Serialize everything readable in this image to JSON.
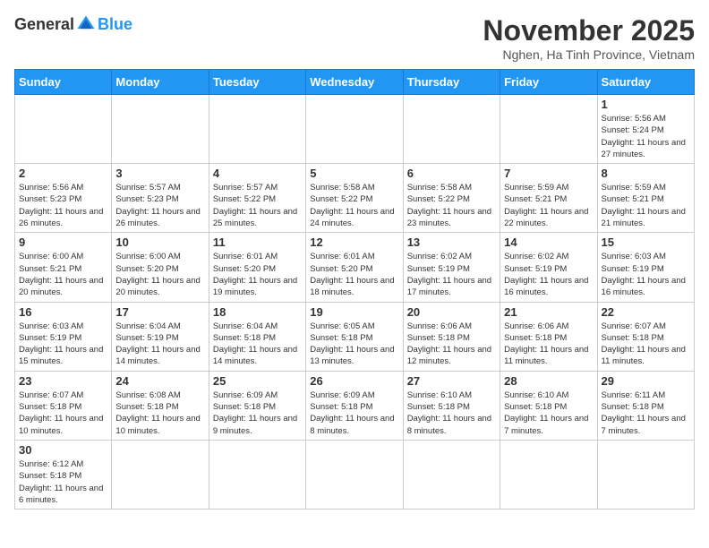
{
  "header": {
    "logo_general": "General",
    "logo_blue": "Blue",
    "month_title": "November 2025",
    "location": "Nghen, Ha Tinh Province, Vietnam"
  },
  "days_of_week": [
    "Sunday",
    "Monday",
    "Tuesday",
    "Wednesday",
    "Thursday",
    "Friday",
    "Saturday"
  ],
  "weeks": [
    [
      {
        "day": "",
        "info": ""
      },
      {
        "day": "",
        "info": ""
      },
      {
        "day": "",
        "info": ""
      },
      {
        "day": "",
        "info": ""
      },
      {
        "day": "",
        "info": ""
      },
      {
        "day": "",
        "info": ""
      },
      {
        "day": "1",
        "info": "Sunrise: 5:56 AM\nSunset: 5:24 PM\nDaylight: 11 hours and 27 minutes."
      }
    ],
    [
      {
        "day": "2",
        "info": "Sunrise: 5:56 AM\nSunset: 5:23 PM\nDaylight: 11 hours and 26 minutes."
      },
      {
        "day": "3",
        "info": "Sunrise: 5:57 AM\nSunset: 5:23 PM\nDaylight: 11 hours and 26 minutes."
      },
      {
        "day": "4",
        "info": "Sunrise: 5:57 AM\nSunset: 5:22 PM\nDaylight: 11 hours and 25 minutes."
      },
      {
        "day": "5",
        "info": "Sunrise: 5:58 AM\nSunset: 5:22 PM\nDaylight: 11 hours and 24 minutes."
      },
      {
        "day": "6",
        "info": "Sunrise: 5:58 AM\nSunset: 5:22 PM\nDaylight: 11 hours and 23 minutes."
      },
      {
        "day": "7",
        "info": "Sunrise: 5:59 AM\nSunset: 5:21 PM\nDaylight: 11 hours and 22 minutes."
      },
      {
        "day": "8",
        "info": "Sunrise: 5:59 AM\nSunset: 5:21 PM\nDaylight: 11 hours and 21 minutes."
      }
    ],
    [
      {
        "day": "9",
        "info": "Sunrise: 6:00 AM\nSunset: 5:21 PM\nDaylight: 11 hours and 20 minutes."
      },
      {
        "day": "10",
        "info": "Sunrise: 6:00 AM\nSunset: 5:20 PM\nDaylight: 11 hours and 20 minutes."
      },
      {
        "day": "11",
        "info": "Sunrise: 6:01 AM\nSunset: 5:20 PM\nDaylight: 11 hours and 19 minutes."
      },
      {
        "day": "12",
        "info": "Sunrise: 6:01 AM\nSunset: 5:20 PM\nDaylight: 11 hours and 18 minutes."
      },
      {
        "day": "13",
        "info": "Sunrise: 6:02 AM\nSunset: 5:19 PM\nDaylight: 11 hours and 17 minutes."
      },
      {
        "day": "14",
        "info": "Sunrise: 6:02 AM\nSunset: 5:19 PM\nDaylight: 11 hours and 16 minutes."
      },
      {
        "day": "15",
        "info": "Sunrise: 6:03 AM\nSunset: 5:19 PM\nDaylight: 11 hours and 16 minutes."
      }
    ],
    [
      {
        "day": "16",
        "info": "Sunrise: 6:03 AM\nSunset: 5:19 PM\nDaylight: 11 hours and 15 minutes."
      },
      {
        "day": "17",
        "info": "Sunrise: 6:04 AM\nSunset: 5:19 PM\nDaylight: 11 hours and 14 minutes."
      },
      {
        "day": "18",
        "info": "Sunrise: 6:04 AM\nSunset: 5:18 PM\nDaylight: 11 hours and 14 minutes."
      },
      {
        "day": "19",
        "info": "Sunrise: 6:05 AM\nSunset: 5:18 PM\nDaylight: 11 hours and 13 minutes."
      },
      {
        "day": "20",
        "info": "Sunrise: 6:06 AM\nSunset: 5:18 PM\nDaylight: 11 hours and 12 minutes."
      },
      {
        "day": "21",
        "info": "Sunrise: 6:06 AM\nSunset: 5:18 PM\nDaylight: 11 hours and 11 minutes."
      },
      {
        "day": "22",
        "info": "Sunrise: 6:07 AM\nSunset: 5:18 PM\nDaylight: 11 hours and 11 minutes."
      }
    ],
    [
      {
        "day": "23",
        "info": "Sunrise: 6:07 AM\nSunset: 5:18 PM\nDaylight: 11 hours and 10 minutes."
      },
      {
        "day": "24",
        "info": "Sunrise: 6:08 AM\nSunset: 5:18 PM\nDaylight: 11 hours and 10 minutes."
      },
      {
        "day": "25",
        "info": "Sunrise: 6:09 AM\nSunset: 5:18 PM\nDaylight: 11 hours and 9 minutes."
      },
      {
        "day": "26",
        "info": "Sunrise: 6:09 AM\nSunset: 5:18 PM\nDaylight: 11 hours and 8 minutes."
      },
      {
        "day": "27",
        "info": "Sunrise: 6:10 AM\nSunset: 5:18 PM\nDaylight: 11 hours and 8 minutes."
      },
      {
        "day": "28",
        "info": "Sunrise: 6:10 AM\nSunset: 5:18 PM\nDaylight: 11 hours and 7 minutes."
      },
      {
        "day": "29",
        "info": "Sunrise: 6:11 AM\nSunset: 5:18 PM\nDaylight: 11 hours and 7 minutes."
      }
    ],
    [
      {
        "day": "30",
        "info": "Sunrise: 6:12 AM\nSunset: 5:18 PM\nDaylight: 11 hours and 6 minutes."
      },
      {
        "day": "",
        "info": ""
      },
      {
        "day": "",
        "info": ""
      },
      {
        "day": "",
        "info": ""
      },
      {
        "day": "",
        "info": ""
      },
      {
        "day": "",
        "info": ""
      },
      {
        "day": "",
        "info": ""
      }
    ]
  ]
}
